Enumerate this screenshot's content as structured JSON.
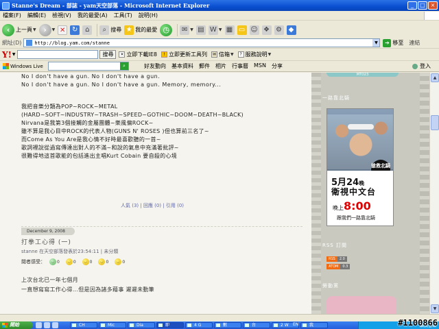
{
  "window": {
    "title": "Stanne's Dream - 部誌 - yam天空部落 - Microsoft Internet Explorer",
    "buttons": [
      "_",
      "□",
      "×"
    ]
  },
  "menubar": [
    "檔案(F)",
    "編輯(E)",
    "檢視(V)",
    "我的最愛(A)",
    "工具(T)",
    "說明(H)"
  ],
  "toolbar": {
    "back": "上一頁",
    "search": "搜尋",
    "favorites": "我的最愛"
  },
  "address": {
    "label": "網址(D)",
    "url": "http://blog.yam.com/stanne",
    "go": "移至",
    "links": "連結"
  },
  "yahoo": {
    "logo": "Y!",
    "search_button": "搜尋",
    "items": [
      "立即下載IE8",
      "立即更新工具列",
      "信箱",
      "服務說明"
    ]
  },
  "livebar": {
    "logo": "Windows Live",
    "menu": [
      "好友動向",
      "基本資料",
      "郵件",
      "相片",
      "行事曆",
      "MSN",
      "分享"
    ],
    "login": "登入"
  },
  "post1": {
    "lyrics": [
      "No I don't have a gun. No I don't have a gun.",
      "No I don't have a gun. No I don't have a gun. Memory, memory..."
    ],
    "paragraphs": [
      "我把音樂分類為POP~ROCK~METAL",
      "(HARD~SOFT~INDUSTRY~TRASH~SPEED~GOTHIC~DOOM~DEATH~BLACK)",
      "Nirvana是我第3個接觸的金屬團體~樂風偏ROCK~",
      "雖不算是我心目中ROCK的代表人物(GUNS N' ROSES )但也算前三名了~",
      "而Come As You Are是我心情不好時最喜歡聽的一首~",
      "歌詞裡說從過寫傳達出對人的不滿~和說的氣息中充滿著批評~",
      "很難得地這首歌能的包括進出主唱Kurt Cobain 要自殺的心境"
    ],
    "meta": "人氣 (3) | 回應 (0) | 引用 (0)"
  },
  "post2": {
    "date": "December 9, 2008",
    "title": "打拳工心得 (一)",
    "info": "stanne 在天空部落發表於23:54:11 | 未分類",
    "mood_label": "閱者感受：",
    "mood_counts": [
      "0",
      "0",
      "0",
      "0",
      "0"
    ],
    "paragraphs": [
      "上次台北已一年七個月",
      "一直想寫寫工作心得...但是因為諸多藉事 遲遲未動筆"
    ]
  },
  "sidebar": {
    "top_tab": "MTD23",
    "heading1": "一路靠北騎",
    "banner": {
      "badge": "搶救北騎",
      "date_num": "5月24",
      "date_suffix": "晚",
      "channel": "衛視中文台",
      "time_prefix": "晚上",
      "time": "8:00",
      "subtitle": "跟我們一路靠北騎"
    },
    "heading2": "RSS 訂閱",
    "rss": [
      {
        "tag": "RSS",
        "ver": "2.0"
      },
      {
        "tag": "ATOM",
        "ver": "0.3"
      }
    ],
    "heading3": "勞動黨"
  },
  "taskbar": {
    "start": "開始",
    "tasks": [
      "CH",
      "Mic",
      "Dia",
      "即",
      "4 G",
      "數",
      "台",
      "2 W",
      "我"
    ],
    "lang": "EN",
    "tray_app": "酷我音樂"
  },
  "watermark": "#1100866"
}
